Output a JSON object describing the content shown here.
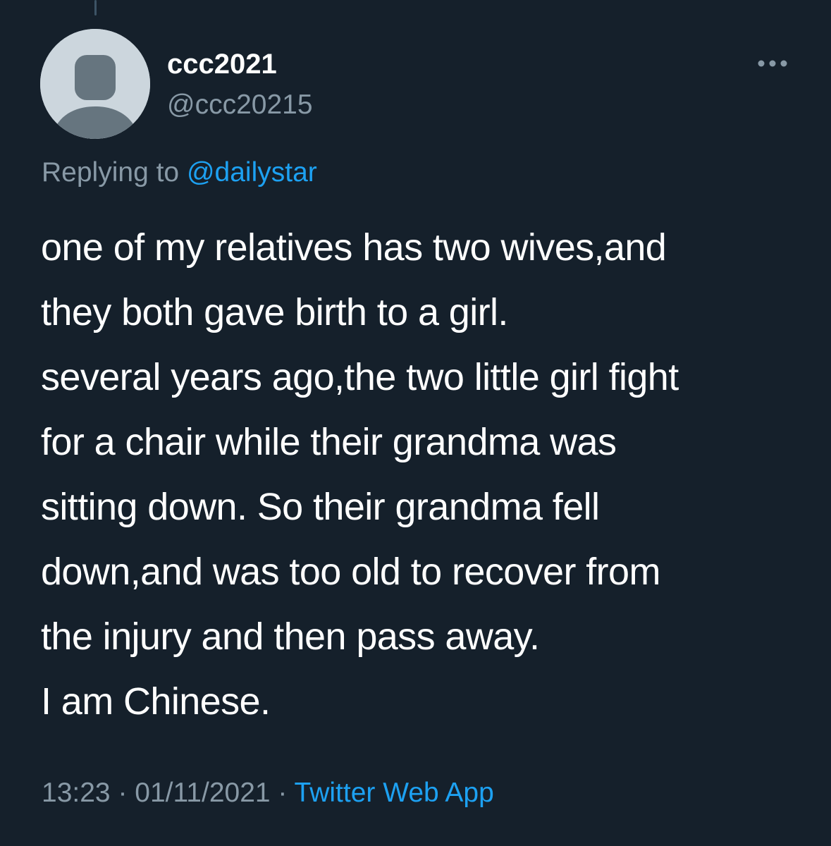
{
  "tweet": {
    "display_name": "ccc2021",
    "handle": "@ccc20215",
    "replying_prefix": "Replying to ",
    "replying_to": "@dailystar",
    "text_lines": [
      "one of my relatives has two wives,and",
      "they both gave birth to a girl.",
      "several years ago,the two little girl fight",
      "for a chair while their grandma was",
      "sitting down. So their grandma fell",
      "down,and was too old to recover from",
      "the injury and then pass away.",
      "I am Chinese."
    ],
    "time": "13:23",
    "separator": " · ",
    "date": "01/11/2021",
    "source": "Twitter Web App"
  },
  "icons": {
    "avatar": "default-profile-avatar-icon",
    "more": "more-horizontal-icon"
  },
  "colors": {
    "background": "#15202b",
    "primary_text": "#ffffff",
    "secondary_text": "#8899a6",
    "accent": "#1da1f2",
    "avatar_bg": "#ccd6dd",
    "avatar_figure": "#66757f"
  }
}
